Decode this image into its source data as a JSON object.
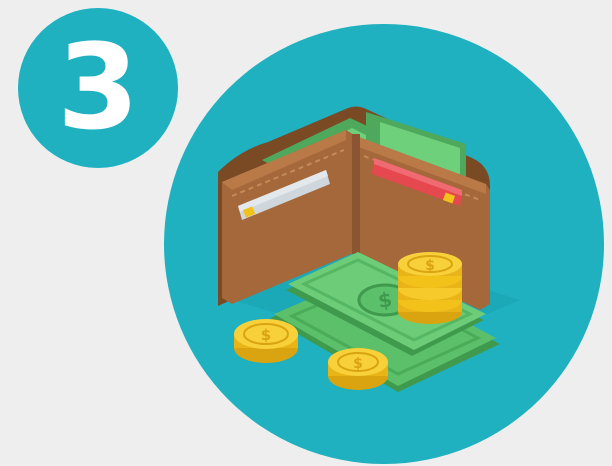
{
  "step": {
    "number": "3"
  },
  "colors": {
    "background": "#eeeeee",
    "accent_teal": "#1fb1c0",
    "wallet_brown": "#a5683a",
    "cash_green": "#5cbf6a",
    "coin_gold": "#f2c21b",
    "card_red": "#e5484f",
    "card_gray": "#d4dbe0"
  },
  "icons": {
    "wallet": "wallet-icon",
    "cash": "cash-bills-icon",
    "coins": "coin-stack-icon"
  }
}
